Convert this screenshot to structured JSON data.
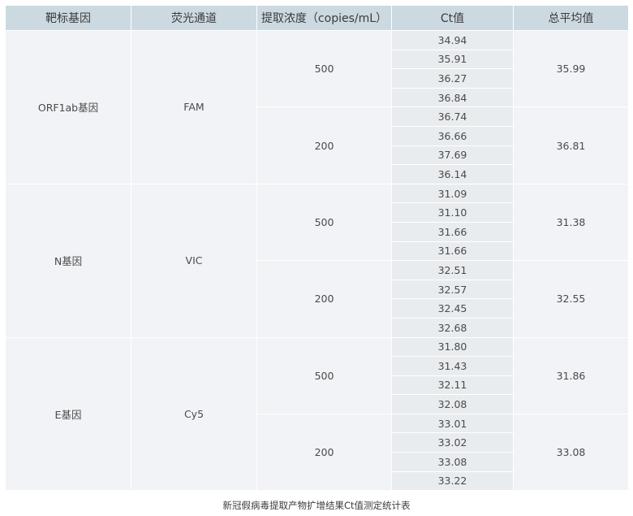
{
  "table": {
    "headers": [
      "靶标基因",
      "荧光通道",
      "提取浓度（copies/mL）",
      "Ct值",
      "总平均值"
    ],
    "groups": [
      {
        "gene": "ORF1ab基因",
        "channel": "FAM",
        "concentrations": [
          {
            "conc": "500",
            "ct": [
              "34.94",
              "35.91",
              "36.27",
              "36.84"
            ],
            "avg": "35.99"
          },
          {
            "conc": "200",
            "ct": [
              "36.74",
              "36.66",
              "37.69",
              "36.14"
            ],
            "avg": "36.81"
          }
        ]
      },
      {
        "gene": "N基因",
        "channel": "VIC",
        "concentrations": [
          {
            "conc": "500",
            "ct": [
              "31.09",
              "31.10",
              "31.66",
              "31.66"
            ],
            "avg": "31.38"
          },
          {
            "conc": "200",
            "ct": [
              "32.51",
              "32.57",
              "32.45",
              "32.68"
            ],
            "avg": "32.55"
          }
        ]
      },
      {
        "gene": "E基因",
        "channel": "Cy5",
        "concentrations": [
          {
            "conc": "500",
            "ct": [
              "31.80",
              "31.43",
              "32.11",
              "32.08"
            ],
            "avg": "31.86"
          },
          {
            "conc": "200",
            "ct": [
              "33.01",
              "33.02",
              "33.08",
              "33.22"
            ],
            "avg": "33.08"
          }
        ]
      }
    ]
  },
  "caption": "新冠假病毒提取产物扩增结果Ct值测定统计表",
  "colors": {
    "header_bg": "#ccd9e1",
    "cell_bg": "#f1f3f6",
    "ct_cell_bg": "#e9ecef"
  }
}
